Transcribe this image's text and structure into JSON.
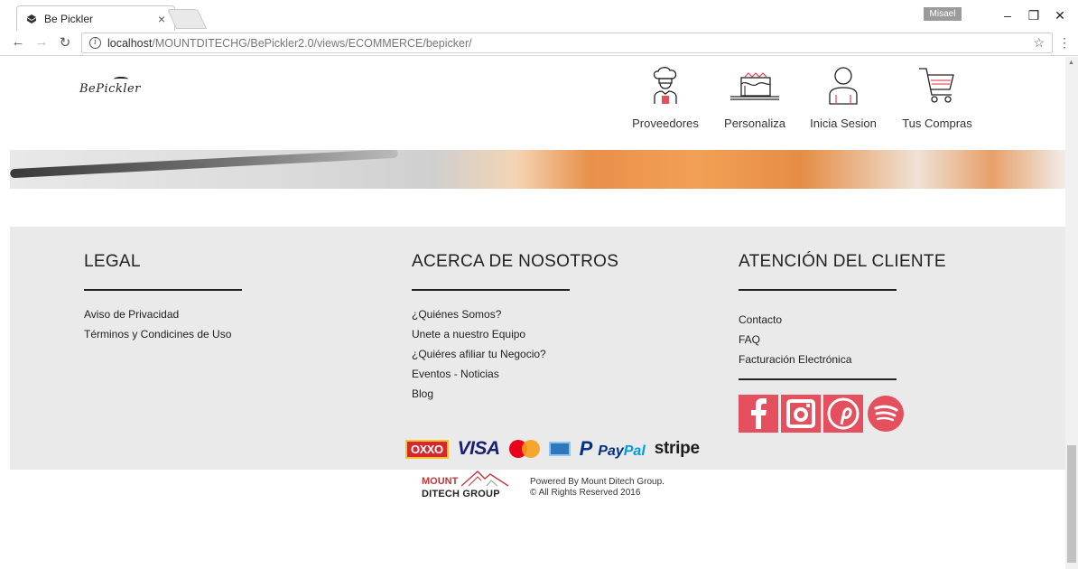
{
  "browser": {
    "tab_title": "Be Pickler",
    "tab_close": "×",
    "profile_name": "Misael",
    "url_host": "localhost",
    "url_path": "/MOUNTDITECHG/BePickler2.0/views/ECOMMERCE/bepicker/",
    "window_buttons": [
      "–",
      "❐",
      "✕"
    ]
  },
  "header": {
    "logo_text": "BePickler",
    "nav": [
      {
        "label": "Proveedores",
        "icon": "chef-icon"
      },
      {
        "label": "Personaliza",
        "icon": "cake-icon"
      },
      {
        "label": "Inicia Sesion",
        "icon": "user-icon"
      },
      {
        "label": "Tus Compras",
        "icon": "cart-icon"
      }
    ]
  },
  "footer": {
    "legal": {
      "title": "LEGAL",
      "links": [
        "Aviso de Privacidad",
        "Términos y Condicines de Uso"
      ]
    },
    "about": {
      "title": "ACERCA DE NOSOTROS",
      "links": [
        "¿Quiénes Somos?",
        "Unete a nuestro Equipo",
        "¿Quiéres afiliar tu Negocio?",
        "Eventos - Noticias",
        "Blog"
      ]
    },
    "support": {
      "title": "ATENCIÓN DEL CLIENTE",
      "links": [
        "Contacto",
        "FAQ",
        "Facturación Electrónica"
      ],
      "social": [
        "facebook-icon",
        "instagram-icon",
        "pinterest-icon",
        "spotify-icon"
      ]
    },
    "social_color": "#e5505f"
  },
  "payments": {
    "oxxo": "OXXO",
    "visa": "VISA",
    "paypal_a": "Pay",
    "paypal_b": "Pal",
    "stripe": "stripe"
  },
  "credits": {
    "company_line1": "MOUNT",
    "company_line2": "DITECH GROUP",
    "powered": "Powered By Mount Ditech Group.",
    "rights": "© All Rights Reserved 2016"
  }
}
